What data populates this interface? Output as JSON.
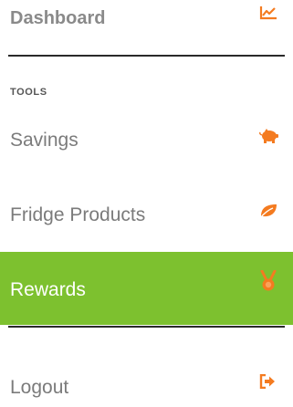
{
  "menu": {
    "dashboard": {
      "label": "Dashboard",
      "icon": "line-chart-icon"
    },
    "tools_heading": "TOOLS",
    "savings": {
      "label": "Savings",
      "icon": "piggy-bank-icon"
    },
    "fridge_products": {
      "label": "Fridge Products",
      "icon": "leaf-icon"
    },
    "rewards": {
      "label": "Rewards",
      "icon": "medal-icon",
      "active": true
    },
    "logout": {
      "label": "Logout",
      "icon": "sign-out-icon"
    }
  },
  "colors": {
    "accent_orange": "#f47b20",
    "active_green": "#7dc12f",
    "text_gray": "#7b7b7b",
    "divider": "#2a2a2a"
  }
}
